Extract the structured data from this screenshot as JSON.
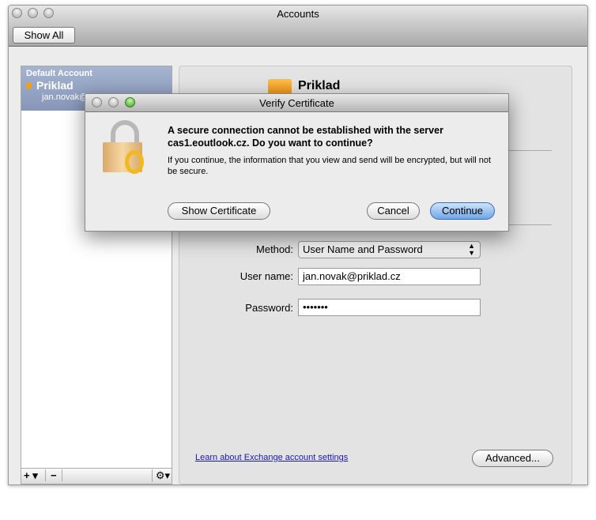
{
  "window": {
    "title": "Accounts",
    "show_all": "Show All"
  },
  "sidebar": {
    "group_label": "Default Account",
    "account_name": "Priklad",
    "account_email": "jan.novak@",
    "add": "+ ▾",
    "remove": "−",
    "gear": "⚙▾",
    "status_color": "#f0a010"
  },
  "panel": {
    "account_title": "Priklad",
    "method_label": "Method:",
    "method_value": "User Name and Password",
    "username_label": "User name:",
    "username_value": "jan.novak@priklad.cz",
    "password_label": "Password:",
    "password_value": "•••••••",
    "learn_link": "Learn about Exchange account settings",
    "advanced": "Advanced..."
  },
  "dialog": {
    "title": "Verify Certificate",
    "heading": "A secure connection cannot be established with the server cas1.eoutlook.cz. Do you want to continue?",
    "body": "If you continue, the information that you view and send will be encrypted, but will not be secure.",
    "show_cert": "Show Certificate",
    "cancel": "Cancel",
    "continue": "Continue"
  },
  "colors": {
    "accent": "#6fa6e6",
    "link": "#1a1aa6"
  }
}
